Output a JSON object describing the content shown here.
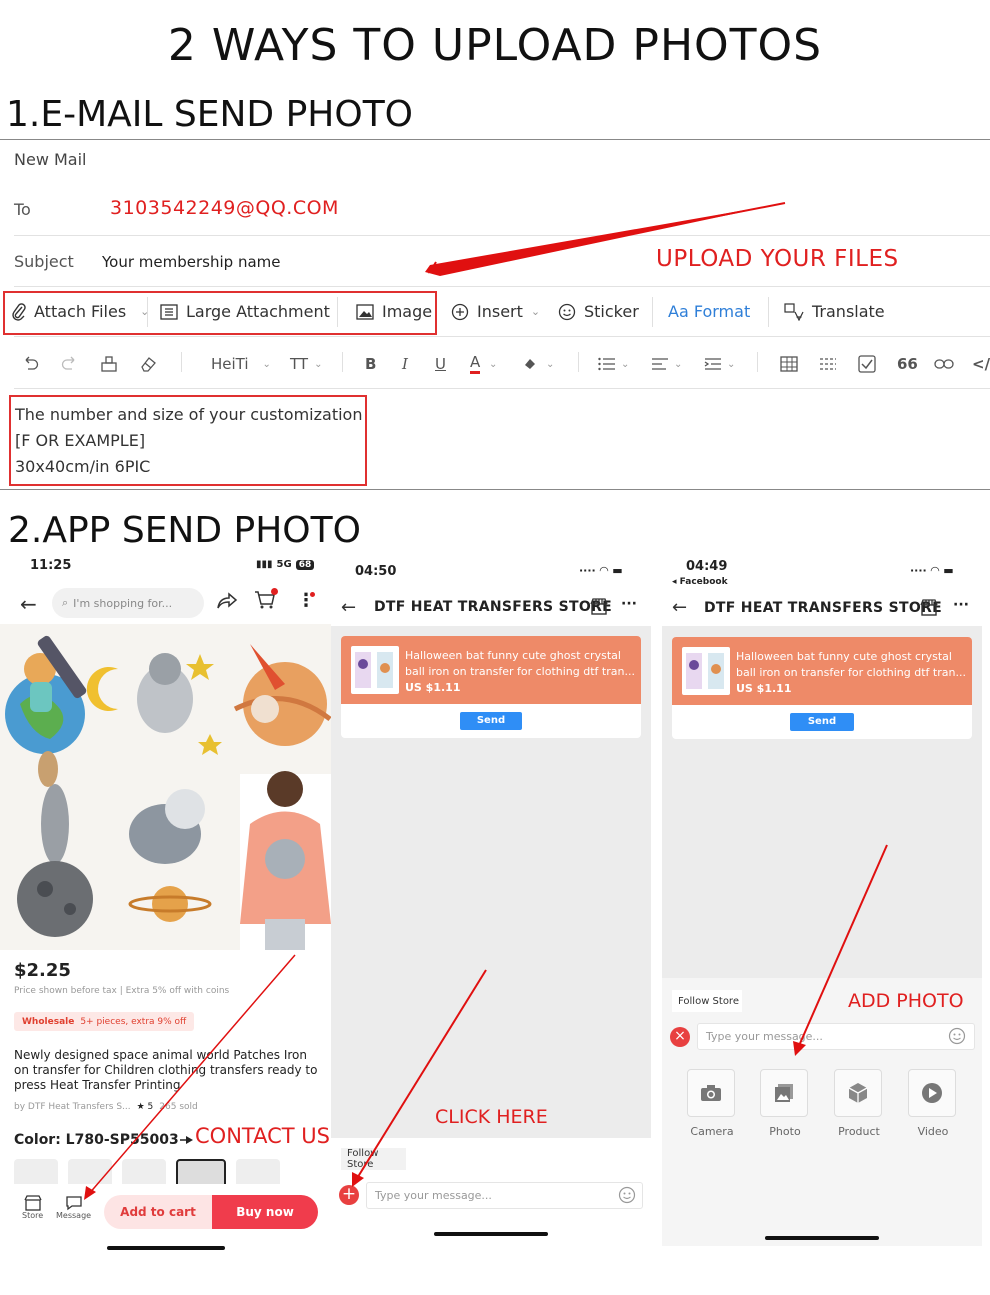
{
  "title": "2 WAYS TO UPLOAD PHOTOS",
  "section1": {
    "heading": "1.E-MAIL SEND PHOTO",
    "new_mail": "New Mail",
    "to_label": "To",
    "to_value": "3103542249@QQ.COM",
    "subject_label": "Subject",
    "subject_value": "Your membership name",
    "callout": "UPLOAD YOUR FILES",
    "toolbar": {
      "attach": "Attach Files",
      "large": "Large Attachment",
      "image": "Image",
      "insert": "Insert",
      "sticker": "Sticker",
      "format": "Aa Format",
      "translate": "Translate"
    },
    "format_bar": {
      "font": "HeiTi",
      "size": "TT",
      "bold": "B",
      "italic": "I",
      "underline": "U",
      "color": "A",
      "quote": "66"
    },
    "body_lines": [
      "The number and size of your  customization",
      "[F OR EXAMPLE]",
      "30x40cm/in  6PIC"
    ]
  },
  "section2": {
    "heading": "2.APP SEND PHOTO",
    "phone1": {
      "time": "11:25",
      "signal": "5G",
      "battery": "68",
      "search_placeholder": "I'm shopping for...",
      "price": "$2.25",
      "price_note": "Price shown before tax | Extra 5% off with coins",
      "wholesale_badge": "Wholesale",
      "wholesale_text": "5+ pieces, extra 9% off",
      "product_title": "Newly designed space animal world Patches Iron on transfer for Children clothing transfers ready to press Heat Transfer Printing",
      "store_line": "by DTF Heat Transfers S...",
      "rating": "5",
      "sold": "265 sold",
      "color_label": "Color: L780-SP55003",
      "contact_us": "CONTACT US",
      "nav_store": "Store",
      "nav_message": "Message",
      "add_to_cart": "Add to cart",
      "buy_now": "Buy now"
    },
    "phone2": {
      "time": "04:50",
      "store_name": "DTF HEAT TRANSFERS STORE",
      "product_line1": "Halloween bat funny cute ghost crystal",
      "product_line2": "ball iron on transfer for clothing dtf tran...",
      "product_price": "US $1.11",
      "send": "Send",
      "click_here": "CLICK HERE",
      "follow_store": "Follow Store",
      "message_placeholder": "Type your message..."
    },
    "phone3": {
      "time": "04:49",
      "back_app": "Facebook",
      "store_name": "DTF HEAT TRANSFERS STORE",
      "product_line1": "Halloween bat funny cute ghost crystal",
      "product_line2": "ball iron on transfer for clothing dtf tran...",
      "product_price": "US $1.11",
      "send": "Send",
      "follow_store": "Follow Store",
      "add_photo": "ADD PHOTO",
      "message_placeholder": "Type your message...",
      "options": [
        "Camera",
        "Photo",
        "Product",
        "Video"
      ]
    }
  }
}
